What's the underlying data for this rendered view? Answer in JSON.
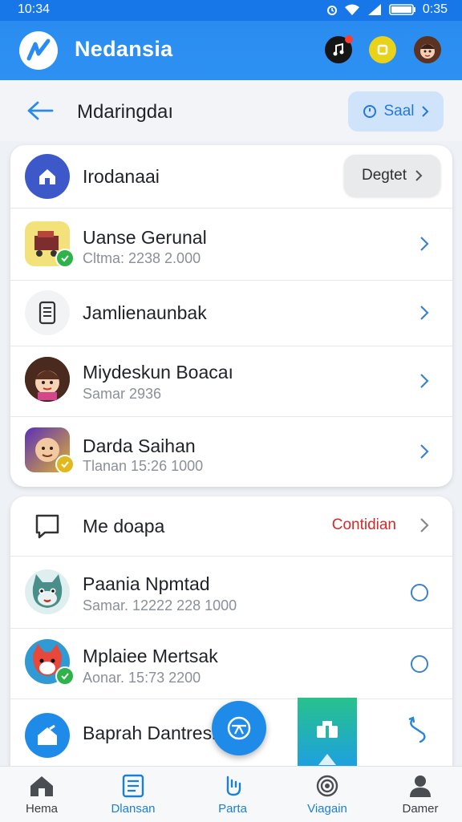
{
  "status_bar": {
    "time_left": "10:34",
    "time_right": "0:35"
  },
  "app": {
    "title": "Nedansia"
  },
  "subheader": {
    "title": "Mdaringdaı",
    "pill_label": "Saal"
  },
  "card1": {
    "rows": [
      {
        "title": "Irodanaai",
        "button_label": "Degtet"
      },
      {
        "title": "Uanse Gerunal",
        "subtitle": "Cltma: 2238 2.000"
      },
      {
        "title": "Jamlienaunbak"
      },
      {
        "title": "Miydeskun Boacaı",
        "subtitle": "Samar 2936"
      },
      {
        "title": "Darda Saihan",
        "subtitle": "Tlanan 15:26 1000"
      }
    ]
  },
  "card2": {
    "rows": [
      {
        "title": "Me doapa",
        "link_label": "Contidian"
      },
      {
        "title": "Paania Npmtad",
        "subtitle": "Samar. 12222 228 1000"
      },
      {
        "title": "Mplaiee Mertsak",
        "subtitle": "Aonar. 15:73 2200"
      },
      {
        "title": "Baprah Dantresb"
      }
    ]
  },
  "bottom_nav": [
    {
      "label": "Hema",
      "icon": "home-icon",
      "active": false
    },
    {
      "label": "Dlansan",
      "icon": "document-icon",
      "active": true
    },
    {
      "label": "Parta",
      "icon": "hand-icon",
      "active": true
    },
    {
      "label": "Viagain",
      "icon": "target-icon",
      "active": true
    },
    {
      "label": "Damer",
      "icon": "person-icon",
      "active": false
    }
  ],
  "colors": {
    "primary": "#2d91f2",
    "accent_red": "#d42a2a",
    "nav_active": "#1a7fd6"
  }
}
